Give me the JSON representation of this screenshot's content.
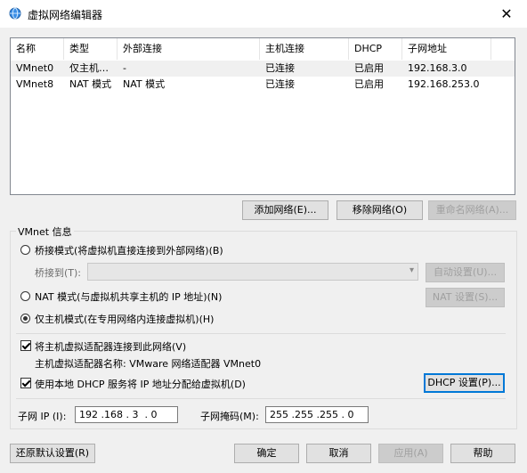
{
  "window": {
    "title": "虚拟网络编辑器",
    "close_glyph": "✕"
  },
  "table": {
    "headers": [
      "名称",
      "类型",
      "外部连接",
      "主机连接",
      "DHCP",
      "子网地址"
    ],
    "rows": [
      [
        "VMnet0",
        "仅主机…",
        "-",
        "已连接",
        "已启用",
        "192.168.3.0"
      ],
      [
        "VMnet8",
        "NAT 模式",
        "NAT 模式",
        "已连接",
        "已启用",
        "192.168.253.0"
      ]
    ]
  },
  "actions": {
    "add_network": "添加网络(E)...",
    "remove_network": "移除网络(O)",
    "rename_network": "重命名网络(A)..."
  },
  "vmnet_info": {
    "title": "VMnet 信息",
    "bridged_label": "桥接模式(将虚拟机直接连接到外部网络)(B)",
    "bridged_to_label": "桥接到(T):",
    "auto_settings": "自动设置(U)...",
    "nat_label": "NAT 模式(与虚拟机共享主机的 IP 地址)(N)",
    "nat_settings": "NAT 设置(S)...",
    "host_only_label": "仅主机模式(在专用网络内连接虚拟机)(H)",
    "selected_mode": "host_only",
    "connect_adapter_label": "将主机虚拟适配器连接到此网络(V)",
    "connect_adapter_checked": true,
    "adapter_name_label": "主机虚拟适配器名称: VMware 网络适配器 VMnet0",
    "use_dhcp_label": "使用本地 DHCP 服务将 IP 地址分配给虚拟机(D)",
    "use_dhcp_checked": true,
    "dhcp_settings": "DHCP 设置(P)...",
    "subnet_ip_label": "子网 IP (I):",
    "subnet_ip_value": "192 .168 . 3  . 0",
    "subnet_mask_label": "子网掩码(M):",
    "subnet_mask_value": "255 .255 .255 . 0"
  },
  "footer": {
    "restore_defaults": "还原默认设置(R)",
    "ok": "确定",
    "cancel": "取消",
    "apply": "应用(A)",
    "help": "帮助"
  },
  "icons": {
    "window_icon": "globe-network-icon",
    "dropdown": "chevron-down-icon"
  },
  "colors": {
    "accent": "#0078d7",
    "title_bg": "#ffffff",
    "dialog_bg": "#f0f0f0"
  }
}
